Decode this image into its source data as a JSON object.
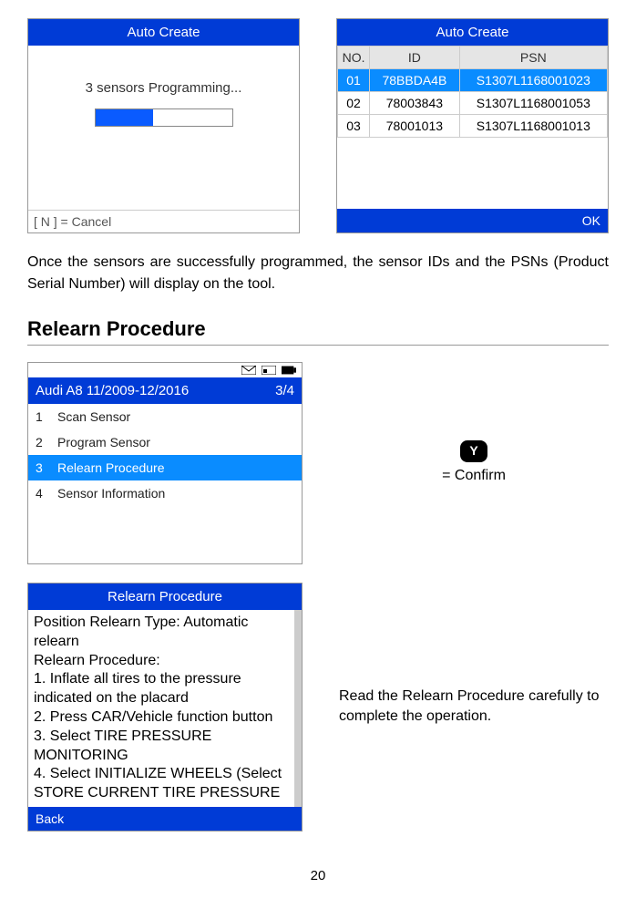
{
  "screen1": {
    "title": "Auto Create",
    "message": "3 sensors Programming...",
    "footer": "[ N ] = Cancel"
  },
  "screen2": {
    "title": "Auto Create",
    "headers": {
      "no": "NO.",
      "id": "ID",
      "psn": "PSN"
    },
    "rows": [
      {
        "no": "01",
        "id": "78BBDA4B",
        "psn": "S1307L1168001023"
      },
      {
        "no": "02",
        "id": "78003843",
        "psn": "S1307L1168001053"
      },
      {
        "no": "03",
        "id": "78001013",
        "psn": "S1307L1168001013"
      }
    ],
    "footer": "OK"
  },
  "para1": "Once the sensors are successfully programmed, the sensor IDs and the PSNs (Product Serial Number) will display on the tool.",
  "section_heading": "Relearn Procedure",
  "screen3": {
    "header_title": "Audi A8 11/2009-12/2016",
    "header_page": "3/4",
    "items": [
      {
        "n": "1",
        "label": "Scan Sensor"
      },
      {
        "n": "2",
        "label": "Program Sensor"
      },
      {
        "n": "3",
        "label": "Relearn Procedure"
      },
      {
        "n": "4",
        "label": "Sensor Information"
      }
    ]
  },
  "confirm": {
    "key": "Y",
    "label": "= Confirm"
  },
  "screen4": {
    "title": "Relearn Procedure",
    "body": "Position Relearn Type: Automatic relearn\nRelearn Procedure:\n1. Inflate all tires to the pressure indicated on the placard\n2. Press CAR/Vehicle function button\n3. Select TIRE PRESSURE MONITORING\n4. Select INITIALIZE WHEELS (Select STORE CURRENT TIRE PRESSURE",
    "footer": "Back"
  },
  "side_note": "Read the Relearn Procedure carefully to complete the operation.",
  "page_number": "20"
}
